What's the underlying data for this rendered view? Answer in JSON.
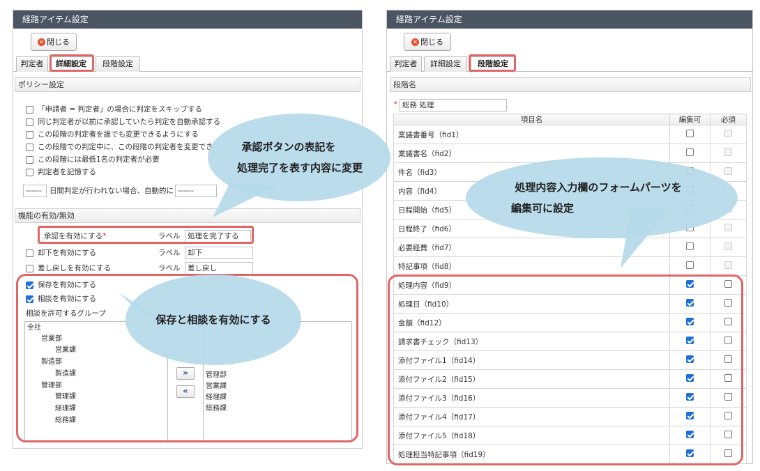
{
  "left": {
    "title": "経路アイテム設定",
    "close_label": "閉じる",
    "tabs": [
      "判定者",
      "詳細設定",
      "段階設定"
    ],
    "policy_section": "ポリシー設定",
    "policies": [
      "「申請者 = 判定者」の場合に判定をスキップする",
      "同じ判定者が以前に承認していたら判定を自動承認する",
      "この段階の判定者を誰でも変更できるようにする",
      "この段階での判定中に、この段階の判定者を変更でき",
      "この段階には最低1名の判定者が必要",
      "判定者を記憶する"
    ],
    "auto_dash1": "------",
    "auto_text": "日間判定が行われない場合、自動的に",
    "auto_dash2": "------",
    "function_section": "機能の有効/無効",
    "approve_label": "承認を有効にする",
    "required_mark": "*",
    "label_word": "ラベル",
    "approve_value": "処理を完了する",
    "reject_label": "却下を有効にする",
    "reject_value": "却下",
    "sendback_label": "差し戻しを有効にする",
    "sendback_value": "差し戻し",
    "save_label": "保存を有効にする",
    "consult_label": "相談を有効にする",
    "groups_label": "相談を許可するグループ",
    "groups": [
      {
        "name": "全社",
        "level": 0
      },
      {
        "name": "営業部",
        "level": 1
      },
      {
        "name": "営業課",
        "level": 2
      },
      {
        "name": "製造部",
        "level": 1
      },
      {
        "name": "製造課",
        "level": 2
      },
      {
        "name": "管理部",
        "level": 1
      },
      {
        "name": "管理課",
        "level": 2
      },
      {
        "name": "経理課",
        "level": 2
      },
      {
        "name": "総務課",
        "level": 2
      }
    ],
    "selected_groups": [
      "管理部",
      "営業課",
      "経理課",
      "総務課"
    ],
    "add_arrow": "»",
    "remove_arrow": "«"
  },
  "right": {
    "title": "経路アイテム設定",
    "close_label": "閉じる",
    "tabs": [
      "判定者",
      "詳細設定",
      "段階設定"
    ],
    "stage_section": "段階名",
    "required_mark": "*",
    "stage_name": "総務 処理",
    "table_headers": [
      "項目名",
      "編集可",
      "必須"
    ],
    "rows": [
      {
        "name": "業議書番号（fid1）",
        "editable": false,
        "required": false,
        "required_disabled": true
      },
      {
        "name": "業議書名（fid2）",
        "editable": false,
        "required": false,
        "required_disabled": true
      },
      {
        "name": "件名（fid3）",
        "editable": false,
        "required": false,
        "required_disabled": true
      },
      {
        "name": "内容（fid4）",
        "editable": false,
        "required": false,
        "required_disabled": true
      },
      {
        "name": "日程開始（fid5）",
        "editable": false,
        "required": false,
        "required_disabled": true
      },
      {
        "name": "日程終了（fid6）",
        "editable": false,
        "required": false,
        "required_disabled": true
      },
      {
        "name": "必要経費（fid7）",
        "editable": false,
        "required": false,
        "required_disabled": true
      },
      {
        "name": "特記事項（fid8）",
        "editable": false,
        "required": false,
        "required_disabled": true
      },
      {
        "name": "処理内容（fid9）",
        "editable": true,
        "required": false,
        "required_disabled": false
      },
      {
        "name": "処理日（fid10）",
        "editable": true,
        "required": false,
        "required_disabled": false
      },
      {
        "name": "金額（fid12）",
        "editable": true,
        "required": false,
        "required_disabled": false
      },
      {
        "name": "請求書チェック（fid13）",
        "editable": true,
        "required": false,
        "required_disabled": false
      },
      {
        "name": "添付ファイル1（fid14）",
        "editable": true,
        "required": false,
        "required_disabled": false
      },
      {
        "name": "添付ファイル2（fid15）",
        "editable": true,
        "required": false,
        "required_disabled": false
      },
      {
        "name": "添付ファイル3（fid16）",
        "editable": true,
        "required": false,
        "required_disabled": false
      },
      {
        "name": "添付ファイル4（fid17）",
        "editable": true,
        "required": false,
        "required_disabled": false
      },
      {
        "name": "添付ファイル5（fid18）",
        "editable": true,
        "required": false,
        "required_disabled": false
      },
      {
        "name": "処理担当特記事項（fid19）",
        "editable": true,
        "required": false,
        "required_disabled": false
      }
    ]
  },
  "callouts": {
    "approve_line1": "承認ボタンの表記を",
    "approve_line2": "処理完了を表す内容に変更",
    "form_line1": "処理内容入力欄のフォームパーツを",
    "form_line2": "編集可に設定",
    "save_text": "保存と相談を有効にする"
  },
  "colors": {
    "titlebar": "#4a5463",
    "highlight": "#e06666",
    "callout": "#b5d9ea",
    "checkbox": "#1f6fd8"
  }
}
